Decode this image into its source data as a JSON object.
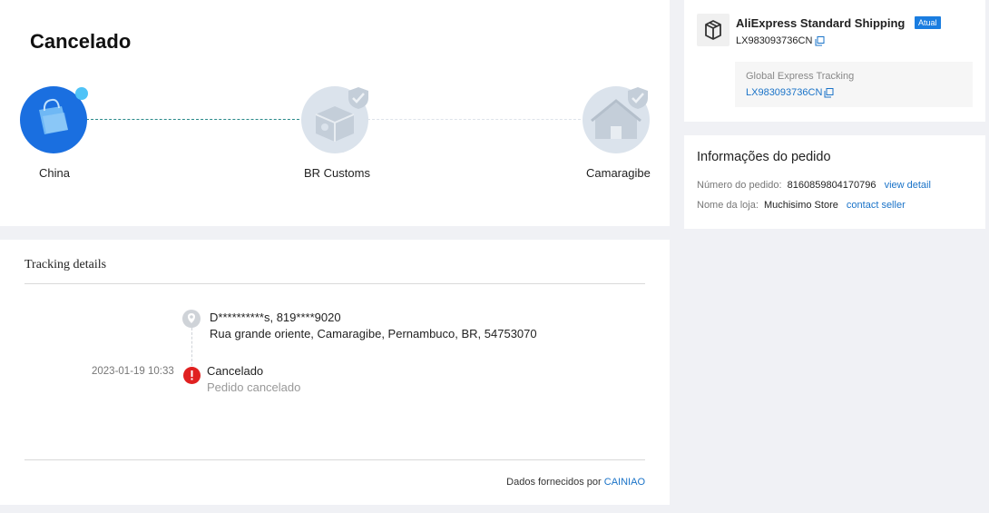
{
  "status": {
    "title": "Cancelado",
    "steps": [
      {
        "label": "China"
      },
      {
        "label": "BR Customs"
      },
      {
        "label": "Camaragibe"
      }
    ]
  },
  "tracking": {
    "section_title": "Tracking details",
    "address_line1": "D**********s,  819****9020",
    "address_line2": "Rua grande oriente,  Camaragibe,  Pernambuco,  BR,  54753070",
    "events": [
      {
        "datetime": "2023-01-19 10:33",
        "title": "Cancelado",
        "description": "Pedido cancelado"
      }
    ],
    "footer_prefix": "Dados fornecidos por",
    "footer_provider": "CAINIAO"
  },
  "shipping": {
    "method": "AliExpress Standard Shipping",
    "badge": "Atual",
    "tracking_code": "LX983093736CN",
    "global_label": "Global Express Tracking",
    "global_code": "LX983093736CN"
  },
  "order": {
    "title": "Informações do pedido",
    "number_label": "Número do pedido:",
    "number_value": "8160859804170796",
    "number_link": "view detail",
    "store_label": "Nome da loja:",
    "store_value": "Muchisimo Store",
    "store_link": "contact seller"
  },
  "colors": {
    "accent_blue": "#1a6fe0",
    "link_blue": "#1a73c8",
    "error_red": "#e02020",
    "inactive_step": "#dbe3ec",
    "page_bg": "#f0f1f5"
  }
}
